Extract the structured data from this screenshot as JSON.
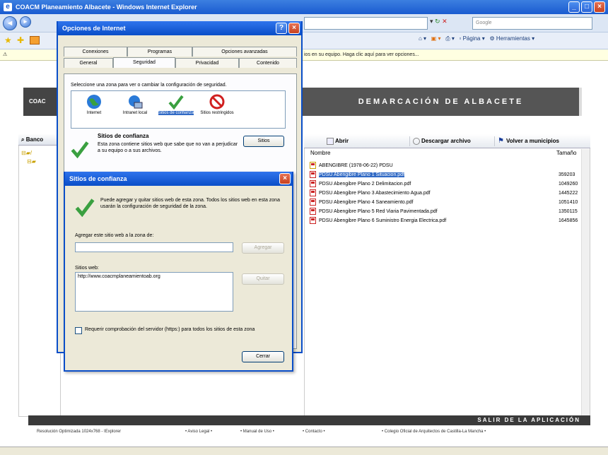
{
  "ie": {
    "window_title": "COACM Planeamiento Albacete - Windows Internet Explorer",
    "search_placeholder": "Google",
    "infobar_text": "Para ayudar a proteger su seguridad, Internet Explorer restringió este archivo para que no muestre contenido activo que podría tener acceso a su equipo. Haga clic aquí para ver opciones...",
    "infobar_right": "ios en su equipo. Haga clic aquí para ver opciones...",
    "page_menu": "Página",
    "tools_menu": "Herramientas"
  },
  "page": {
    "banner_left": "COAC",
    "banner_right": "DEMARCACIÓN DE ALBACETE",
    "left_header": "Banco",
    "toolbar": {
      "open": "Abrir",
      "download": "Descargar archivo",
      "back": "Volver a municipios"
    },
    "columns": {
      "name": "Nombre",
      "size": "Tamaño"
    },
    "files": [
      {
        "name": "ABENGIBRE (1978-06-22) PDSU",
        "size": ""
      },
      {
        "name": "PDSU Abengibre Plano 1 Situacion.pdf",
        "size": "359203"
      },
      {
        "name": "PDSU Abengibre Plano 2 Delimitacion.pdf",
        "size": "1049260"
      },
      {
        "name": "PDSU Abengibre Plano 3 Abastecimiento Agua.pdf",
        "size": "1445222"
      },
      {
        "name": "PDSU Abengibre Plano 4 Saneamiento.pdf",
        "size": "1051410"
      },
      {
        "name": "PDSU Abengibre Plano 5 Red Viaria Pavimentada.pdf",
        "size": "1350115"
      },
      {
        "name": "PDSU Abengibre Plano 6 Suministro Energia Electrica.pdf",
        "size": "1645856"
      }
    ],
    "bottom_bar": "SALIR DE LA APLICACIÓN",
    "footer": {
      "resolution": "Resolución Optimizada 1024x768 - IExplorer",
      "legal": "• Aviso Legal •",
      "manual": "• Manual de Uso •",
      "contact": "• Contacto •",
      "college": "• Colegio Oficial de Arquitectos de Castilla-La Mancha •"
    }
  },
  "internet_options": {
    "title": "Opciones de Internet",
    "tabs_row1": [
      "Conexiones",
      "Programas",
      "Opciones avanzadas"
    ],
    "tabs_row2": [
      "General",
      "Seguridad",
      "Privacidad",
      "Contenido"
    ],
    "zone_prompt": "Seleccione una zona para ver o cambiar la configuración de seguridad.",
    "zones": [
      {
        "label": "Internet",
        "icon": "globe-icon"
      },
      {
        "label": "Intranet local",
        "icon": "intranet-icon"
      },
      {
        "label": "Sitios de confianza",
        "icon": "checkmark-icon"
      },
      {
        "label": "Sitios restringidos",
        "icon": "restricted-icon"
      }
    ],
    "zone_title": "Sitios de confianza",
    "zone_desc": "Esta zona contiene sitios web que sabe que no van a perjudicar a su equipo o a sus archivos.",
    "sites_button": "Sitios"
  },
  "trusted_sites": {
    "title": "Sitios de confianza",
    "description": "Puede agregar y quitar sitios web de esta zona. Todos los sitios web en esta zona usarán la configuración de seguridad de la zona.",
    "add_label": "Agregar este sitio web a la zona de:",
    "add_value": "",
    "add_button": "Agregar",
    "websites_label": "Sitios web:",
    "websites": [
      "http://www.coacmplaneamientoab.org"
    ],
    "remove_button": "Quitar",
    "require_https": "Requerir comprobación del servidor (https:) para todos los sitios de esta zona",
    "require_https_checked": false,
    "close_button": "Cerrar"
  }
}
